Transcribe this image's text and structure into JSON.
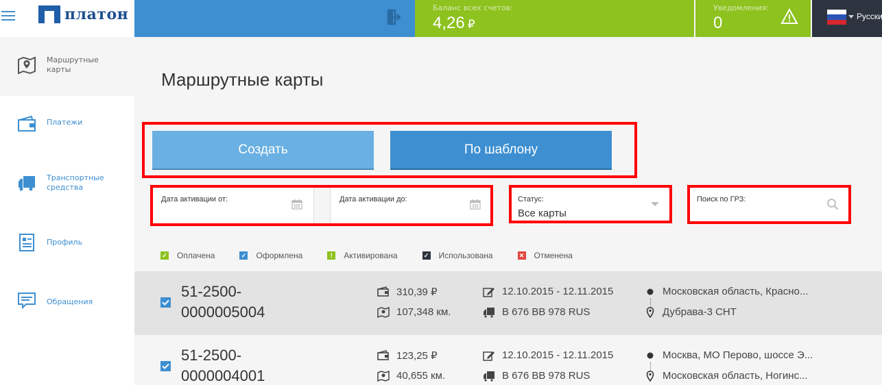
{
  "header": {
    "logo_text": "платон",
    "balance_label": "Баланс всех счетов:",
    "balance_value": "4,26",
    "balance_currency": "₽",
    "notifications_label": "Уведомления:",
    "notifications_value": "0",
    "language": "Русский"
  },
  "colors": {
    "accent_blue": "#3d8fd1",
    "accent_green": "#8dc21f",
    "dark": "#2d3440",
    "highlight_red": "#ff0000"
  },
  "sidebar": {
    "items": [
      {
        "label": "Маршрутные карты",
        "icon": "map-icon",
        "active": true
      },
      {
        "label": "Платежи",
        "icon": "wallet-icon",
        "active": false
      },
      {
        "label": "Транспортные средства",
        "icon": "truck-icon",
        "active": false
      },
      {
        "label": "Профиль",
        "icon": "profile-icon",
        "active": false
      },
      {
        "label": "Обращения",
        "icon": "message-icon",
        "active": false
      }
    ]
  },
  "main": {
    "title": "Маршрутные карты",
    "create_button": "Создать",
    "template_button": "По шаблону",
    "filters": {
      "date_from_label": "Дата активации от:",
      "date_to_label": "Дата активации до:",
      "status_label": "Статус:",
      "status_value": "Все карты",
      "search_label": "Поиск по ГРЗ:"
    },
    "legend": [
      {
        "label": "Оплачена",
        "color": "#8dc21f",
        "mark": "✓"
      },
      {
        "label": "Оформлена",
        "color": "#3d8fd1",
        "mark": "✓"
      },
      {
        "label": "Активирована",
        "color": "#8dc21f",
        "mark": "!"
      },
      {
        "label": "Использована",
        "color": "#2d3440",
        "mark": "✓"
      },
      {
        "label": "Отменена",
        "color": "#e0463c",
        "mark": "✕"
      }
    ],
    "cards": [
      {
        "number_line1": "51-2500-",
        "number_line2": "0000005004",
        "amount": "310,39 ₽",
        "distance": "107,348 км.",
        "period": "12.10.2015 - 12.11.2015",
        "vehicle": "В 676 ВВ 978 RUS",
        "from": "Московская область, Красно...",
        "to": "Дубрава-3 СНТ"
      },
      {
        "number_line1": "51-2500-",
        "number_line2": "0000004001",
        "amount": "123,25 ₽",
        "distance": "40,655 км.",
        "period": "12.10.2015 - 12.11.2015",
        "vehicle": "В 676 ВВ 978 RUS",
        "from": "Москва, МО Перово, шоссе Э...",
        "to": "Московская область, Ногинс..."
      }
    ]
  }
}
